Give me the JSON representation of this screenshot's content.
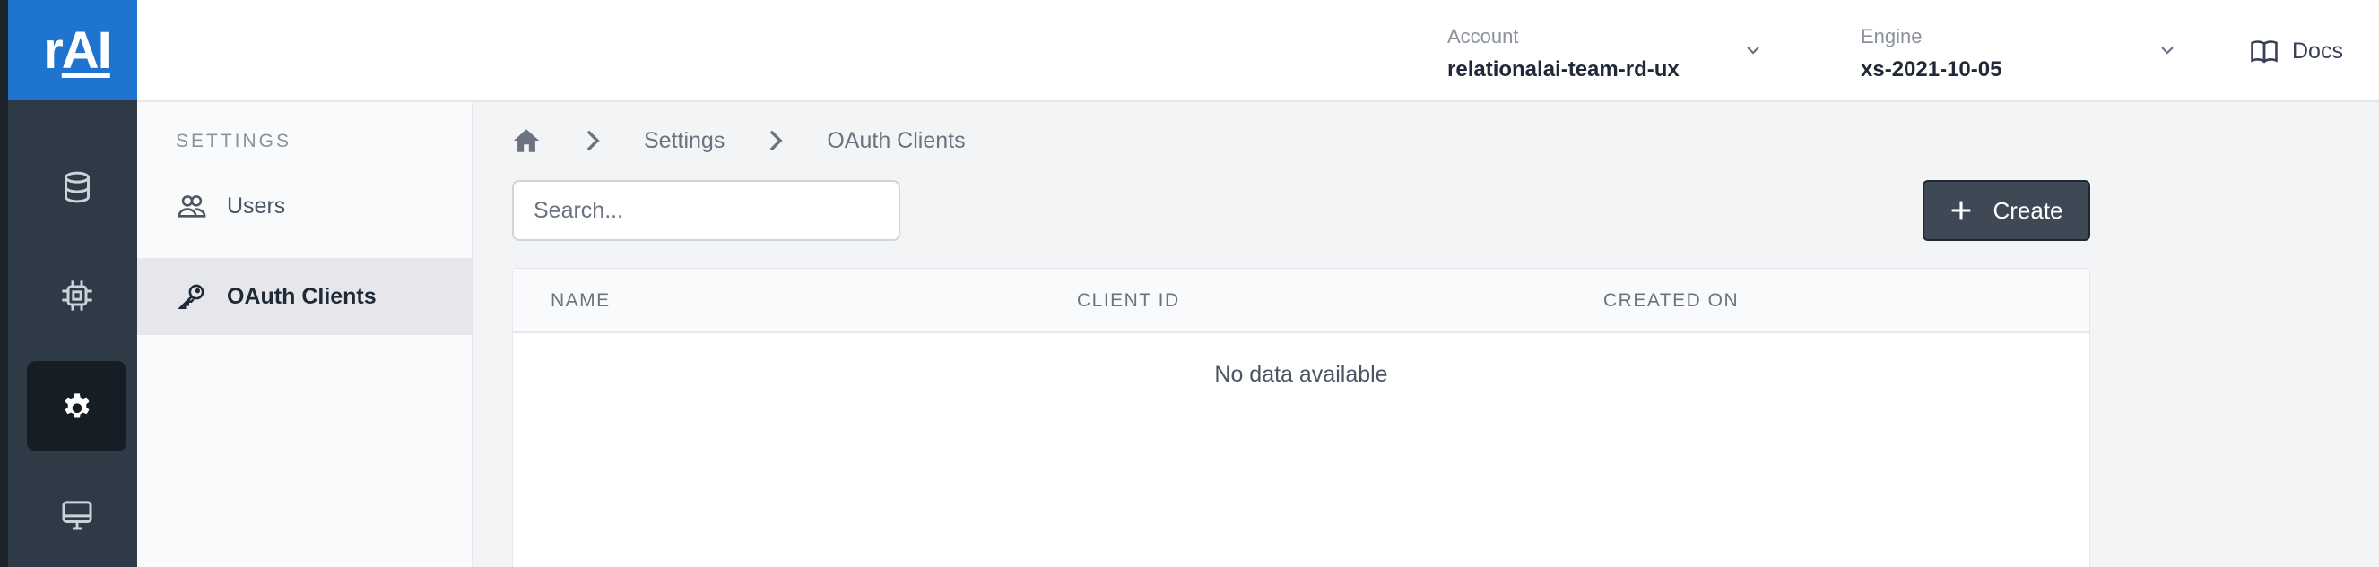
{
  "app": {
    "logo_text_r": "r",
    "logo_text_ai": "AI"
  },
  "rail": {
    "items": [
      {
        "icon": "database-icon",
        "active": false
      },
      {
        "icon": "chip-icon",
        "active": false
      },
      {
        "icon": "gear-icon",
        "active": true
      },
      {
        "icon": "monitor-icon",
        "active": false
      }
    ]
  },
  "header": {
    "account_label": "Account",
    "account_value": "relationalai-team-rd-ux",
    "engine_label": "Engine",
    "engine_value": "xs-2021-10-05",
    "docs_label": "Docs"
  },
  "sidebar": {
    "title": "SETTINGS",
    "items": [
      {
        "label": "Users",
        "icon": "users-icon",
        "active": false
      },
      {
        "label": "OAuth Clients",
        "icon": "key-icon",
        "active": true
      }
    ]
  },
  "breadcrumb": {
    "items": [
      "Settings",
      "OAuth Clients"
    ]
  },
  "toolbar": {
    "search_placeholder": "Search...",
    "create_label": "Create"
  },
  "table": {
    "columns": [
      "NAME",
      "CLIENT ID",
      "CREATED ON"
    ],
    "empty_text": "No data available"
  },
  "colors": {
    "brand": "#1f74d0",
    "rail": "#2f3a47",
    "button": "#3f4955"
  }
}
